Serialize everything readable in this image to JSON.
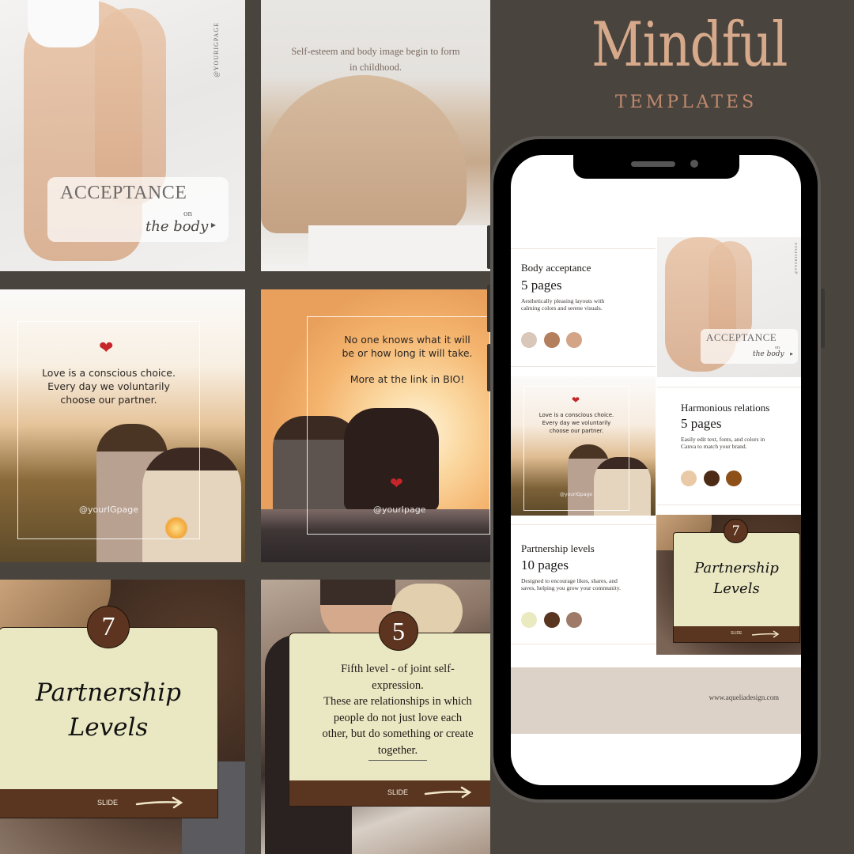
{
  "brand": {
    "title": "Mindful",
    "subtitle": "TEMPLATES",
    "title_color": "#d6a98a",
    "subtitle_color": "#c08a6e"
  },
  "background_color": "#4a443e",
  "tiles": {
    "acceptance": {
      "handle": "@YOURIGPAGE",
      "title": "ACCEPTANCE",
      "on": "on",
      "script": "the body",
      "arrow_icon": "play-arrow-icon"
    },
    "self_esteem": {
      "text_line1": "Self-esteem and body image begin to form",
      "text_line2": "in childhood."
    },
    "love_choice": {
      "heart_icon": "heart-icon",
      "line1": "Love is a conscious choice.",
      "line2": "Every day we voluntarily",
      "line3": "choose our partner.",
      "handle": "@yourIGpage"
    },
    "no_one_knows": {
      "line1": "No one knows what it will",
      "line2": "be or how long it will take.",
      "line3": "More at the link in BIO!",
      "heart_icon": "heart-icon",
      "handle": "@yourIpage"
    },
    "partnership_levels": {
      "number": "7",
      "title_line1": "Partnership",
      "title_line2": "Levels",
      "slide_label": "SLIDE"
    },
    "fifth_level": {
      "number": "5",
      "line1": "Fifth level - of joint self-",
      "line2": "expression.",
      "line3": "These are relationships in which",
      "line4": "people do not just love each",
      "line5": "other, but do something or create",
      "line6": "together.",
      "slide_label": "SLIDE"
    }
  },
  "phone": {
    "products": [
      {
        "name": "Body acceptance",
        "pages": "5 pages",
        "description_line1": "Aesthetically pleasing layouts with",
        "description_line2": "calming colors and serene visuals.",
        "swatches": [
          "#d9c8ba",
          "#b47f5d",
          "#d3a486"
        ]
      },
      {
        "name": "Harmonious relations",
        "pages": "5 pages",
        "description_line1": "Easily edit text, fonts, and colors in",
        "description_line2": "Canva to match your brand.",
        "swatches": [
          "#eac9a6",
          "#4c2a16",
          "#8e5019"
        ]
      },
      {
        "name": "Partnership levels",
        "pages": "10 pages",
        "description_line1": "Designed to encourage likes, shares, and",
        "description_line2": "saves, helping you grow your community.",
        "swatches": [
          "#eaeac0",
          "#5a3520",
          "#a07a68"
        ]
      }
    ],
    "mini_acceptance": {
      "handle": "@YOURIGPAGE",
      "title": "ACCEPTANCE",
      "on": "on",
      "script": "the body"
    },
    "mini_love": {
      "line1": "Love is a conscious choice.",
      "line2": "Every day we voluntarily",
      "line3": "choose our partner.",
      "handle": "@yourIGpage"
    },
    "mini_partnership": {
      "number": "7",
      "title_line1": "Partnership",
      "title_line2": "Levels",
      "slide_label": "SLIDE"
    },
    "footer_url": "www.aqueliadesign.com"
  }
}
